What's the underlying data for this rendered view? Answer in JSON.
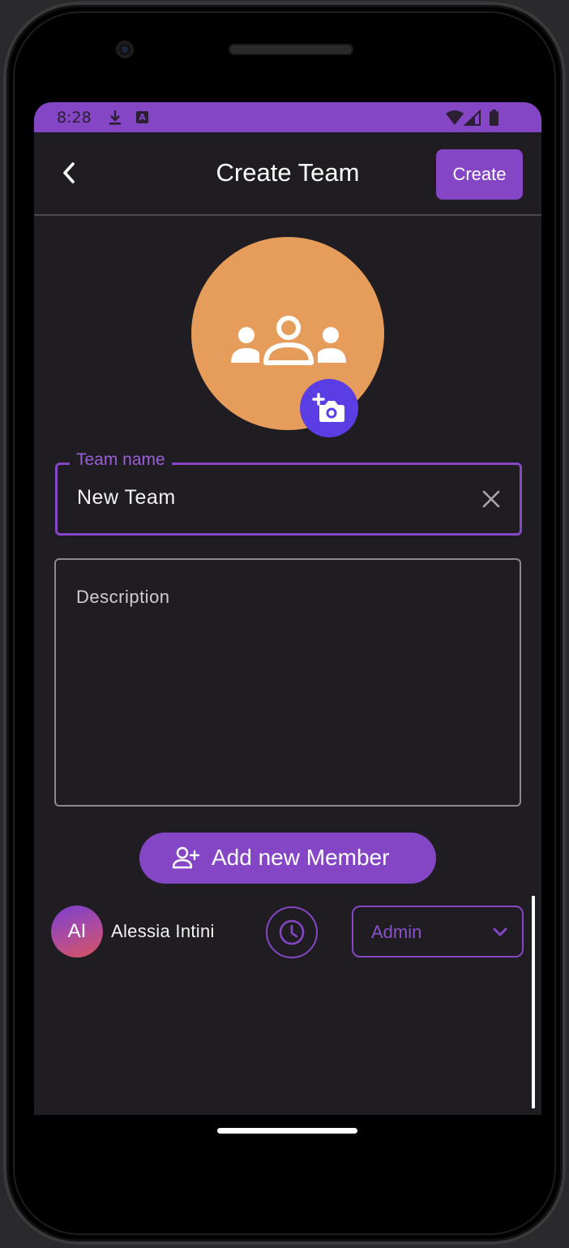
{
  "status_bar": {
    "time": "8:28",
    "background": "#8446c4",
    "icons": [
      "download-icon",
      "a-app-icon",
      "wifi-icon",
      "signal-icon",
      "battery-icon"
    ]
  },
  "app_bar": {
    "title": "Create Team",
    "back_icon": "chevron-left-icon",
    "create_label": "Create"
  },
  "team_avatar": {
    "icon": "groups-icon",
    "background": "#e69c5a",
    "camera_icon": "add-a-photo-icon",
    "camera_background": "#5a3ee4"
  },
  "team_name_field": {
    "label": "Team name",
    "value": "New Team",
    "clear_icon": "close-icon"
  },
  "description_field": {
    "placeholder": "Description"
  },
  "add_member": {
    "label": "Add new Member",
    "icon": "person-add-icon"
  },
  "members": [
    {
      "initials": "AI",
      "name": "Alessia Intini",
      "clock_icon": "clock-icon",
      "role": "Admin",
      "chevron_icon": "chevron-down-icon"
    }
  ],
  "colors": {
    "accent": "#8446c4",
    "background": "#1f1d21",
    "text": "#f2f2f2"
  }
}
